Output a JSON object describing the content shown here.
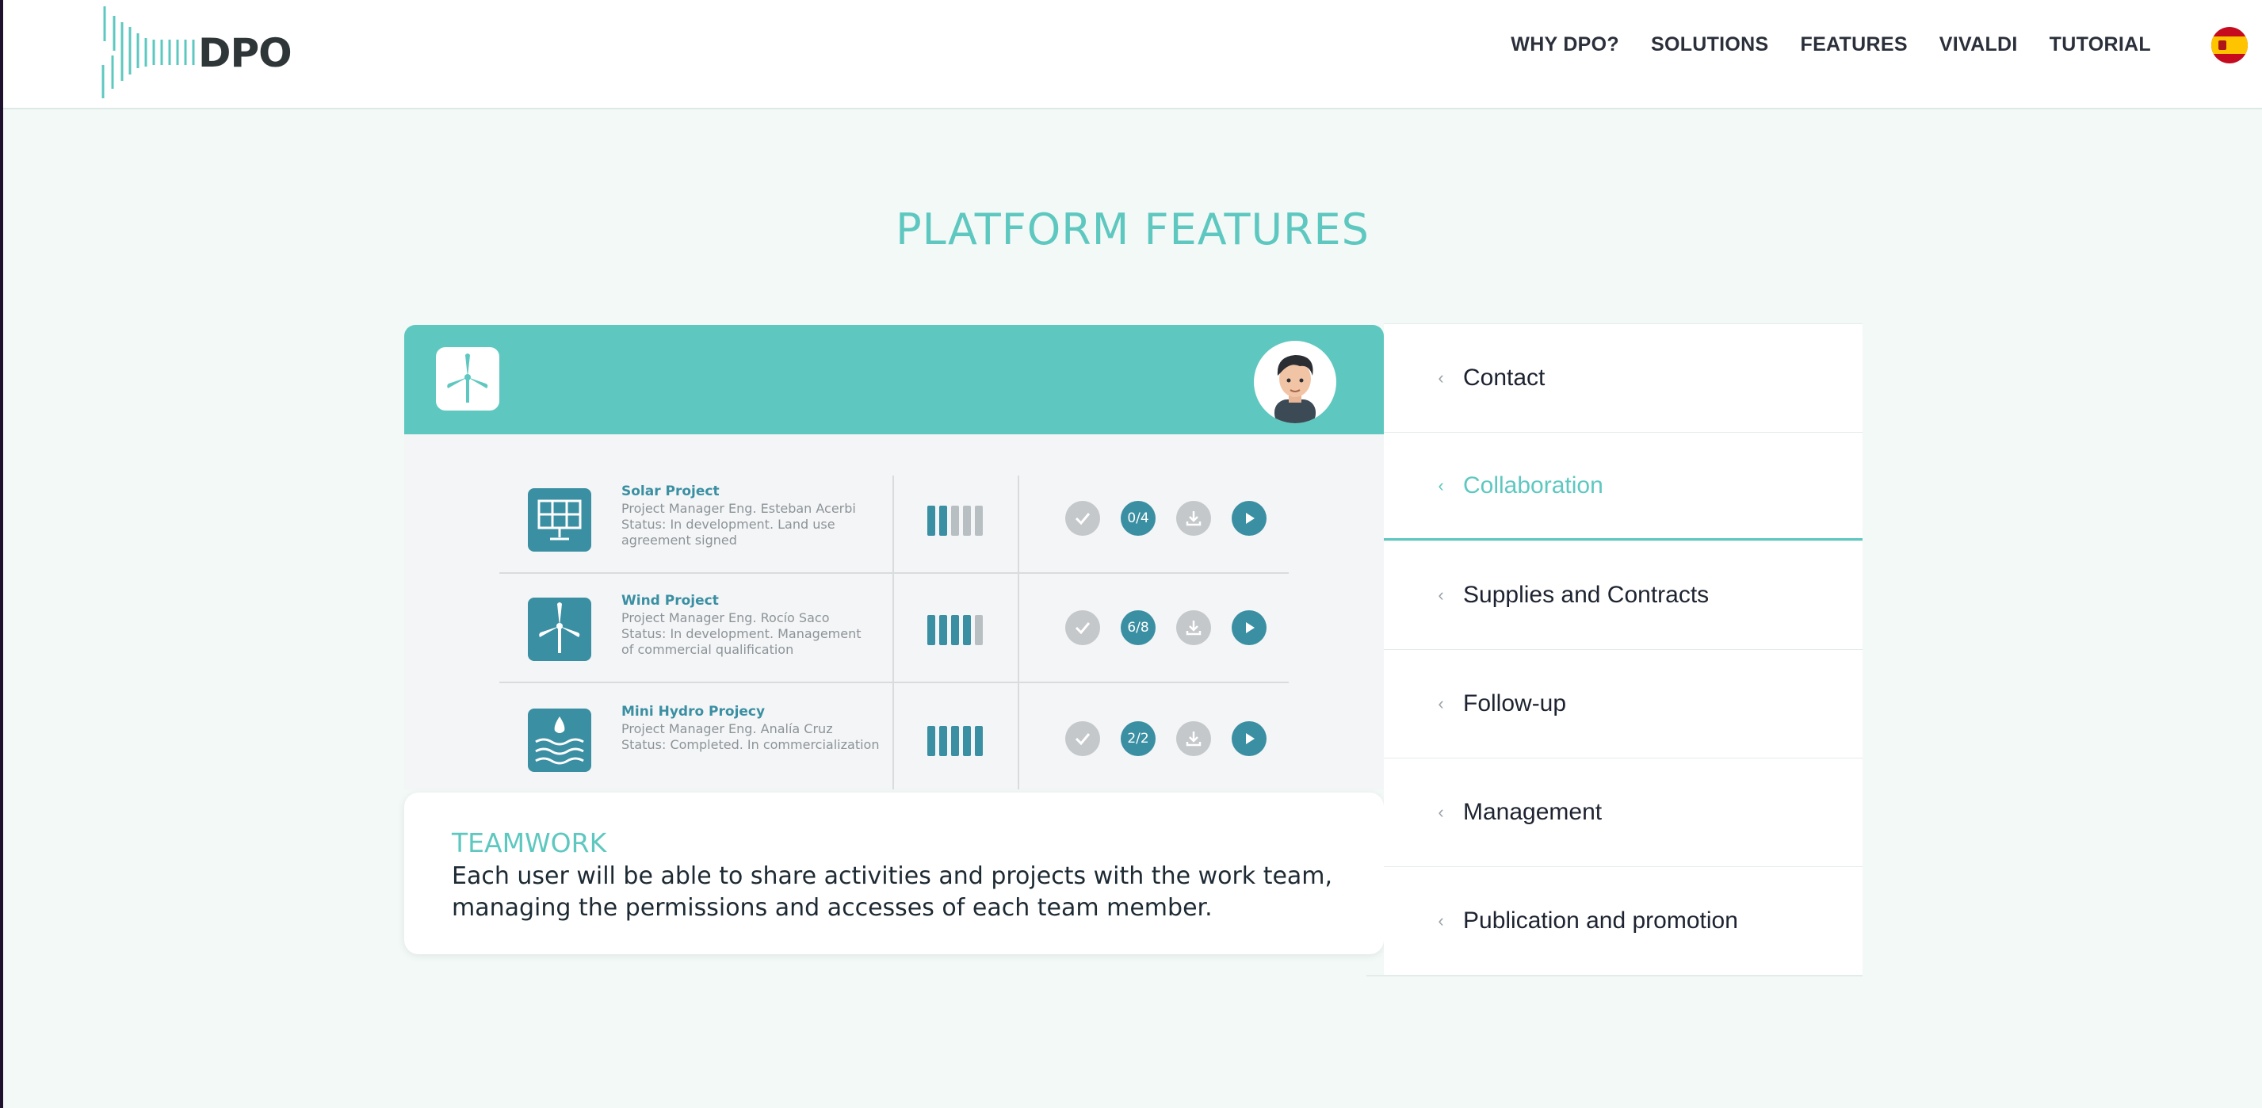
{
  "header": {
    "logo_text": "DPO",
    "nav": [
      "WHY DPO?",
      "SOLUTIONS",
      "FEATURES",
      "VIVALDI",
      "TUTORIAL"
    ]
  },
  "section": {
    "title": "PLATFORM FEATURES"
  },
  "preview": {
    "projects": [
      {
        "icon": "solar-panel-icon",
        "title": "Solar Project",
        "manager": "Project Manager Eng. Esteban Acerbi",
        "status_lines": [
          "Status: In development. Land use",
          "agreement signed"
        ],
        "progress": 0.4,
        "counter": "0/4"
      },
      {
        "icon": "wind-turbine-icon",
        "title": "Wind Project",
        "manager": "Project Manager Eng. Rocío Saco",
        "status_lines": [
          "Status: In development. Management",
          "of commercial qualification"
        ],
        "progress": 0.8,
        "counter": "6/8"
      },
      {
        "icon": "hydro-water-icon",
        "title": "Mini Hydro Projecy",
        "manager": "Project Manager Eng. Analía Cruz",
        "status_lines": [
          "Status: Completed. In commercialization"
        ],
        "progress": 1.0,
        "counter": "2/2"
      }
    ]
  },
  "description": {
    "title": "TEAMWORK",
    "text": "Each user will be able to share activities and projects with the work team, managing the permissions and accesses of each team member."
  },
  "features": {
    "active_index": 1,
    "items": [
      "Contact",
      "Collaboration",
      "Supplies and Contracts",
      "Follow-up",
      "Management",
      "Publication and promotion"
    ]
  },
  "colors": {
    "accent": "#5ec8c0",
    "project_teal": "#3a8fa3",
    "bar_inactive": "#b8bfc3",
    "action_gray": "#c4c8ca"
  }
}
